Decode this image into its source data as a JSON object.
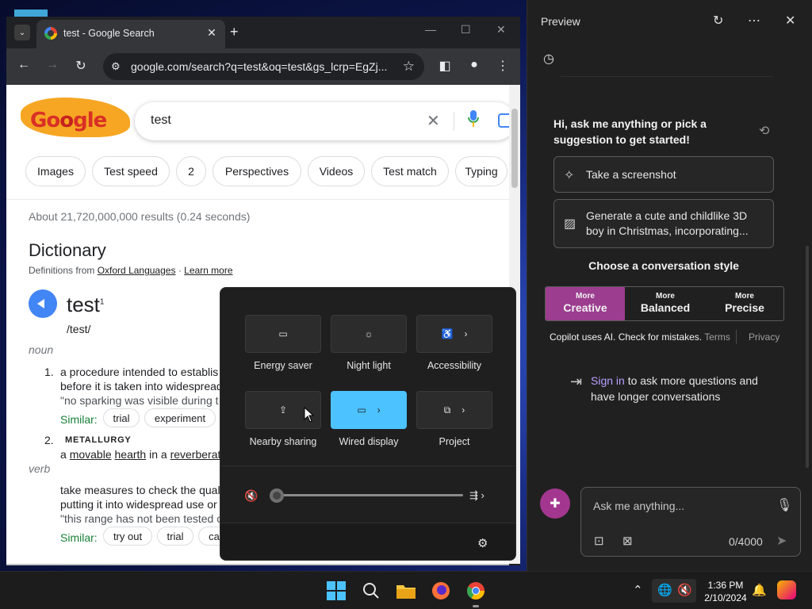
{
  "browser": {
    "tab_title": "test - Google Search",
    "url": "google.com/search?q=test&oq=test&gs_lcrp=EgZj..."
  },
  "google": {
    "logo_text": "Google",
    "query": "test",
    "chips": [
      "Images",
      "Test speed",
      "2",
      "Perspectives",
      "Videos",
      "Test match",
      "Typing"
    ],
    "stats": "About 21,720,000,000 results (0.24 seconds)",
    "dictionary_title": "Dictionary",
    "definitions_from": "Definitions from",
    "oxford": "Oxford Languages",
    "learn_more": "Learn more",
    "word": "test",
    "superscript": "1",
    "phonetic": "/test/",
    "pos_noun": "noun",
    "def1_num": "1.",
    "def1_line1": "a procedure intended to establis",
    "def1_line2": "before it is taken into widespread",
    "def1_example": "\"no sparking was visible during t",
    "similar_label": "Similar:",
    "similar1": [
      "trial",
      "experiment"
    ],
    "def2_num": "2.",
    "def2_domain": "METALLURGY",
    "def2_a": "a",
    "def2_movable": "movable",
    "def2_hearth": "hearth",
    "def2_in": "in a",
    "def2_rev": "reverberat",
    "pos_verb": "verb",
    "def3_line1": "take measures to check the qual",
    "def3_line2": "putting it into widespread use or",
    "def3_example": "\"this range has not been tested c",
    "similar2": [
      "try out",
      "trial",
      "ca"
    ]
  },
  "quick_settings": {
    "tiles": [
      {
        "label": "Energy saver",
        "icon": "battery-leaf-icon"
      },
      {
        "label": "Night light",
        "icon": "sun-icon"
      },
      {
        "label": "Accessibility",
        "icon": "accessibility-icon"
      },
      {
        "label": "Nearby sharing",
        "icon": "share-icon"
      },
      {
        "label": "Wired display",
        "icon": "cast-icon"
      },
      {
        "label": "Project",
        "icon": "project-icon"
      }
    ],
    "active_tile": "Wired display",
    "volume": 0
  },
  "copilot": {
    "title": "Preview",
    "greeting": "Hi, ask me anything or pick a suggestion to get started!",
    "suggestions": [
      "Take a screenshot",
      "Generate a cute and childlike 3D boy in Christmas, incorporating..."
    ],
    "style_title": "Choose a conversation style",
    "styles": [
      {
        "small": "More",
        "large": "Creative"
      },
      {
        "small": "More",
        "large": "Balanced"
      },
      {
        "small": "More",
        "large": "Precise"
      }
    ],
    "selected_style": "Creative",
    "disclaimer": "Copilot uses AI. Check for mistakes.",
    "terms": "Terms",
    "privacy": "Privacy",
    "signin_link": "Sign in",
    "signin_rest": "to ask more questions and have longer conversations",
    "input_placeholder": "Ask me anything...",
    "char_count": "0/4000",
    "accent_color": "#9c3d8f"
  },
  "taskbar": {
    "time": "1:36 PM",
    "date": "2/10/2024",
    "accent_color": "#4cc2ff"
  }
}
